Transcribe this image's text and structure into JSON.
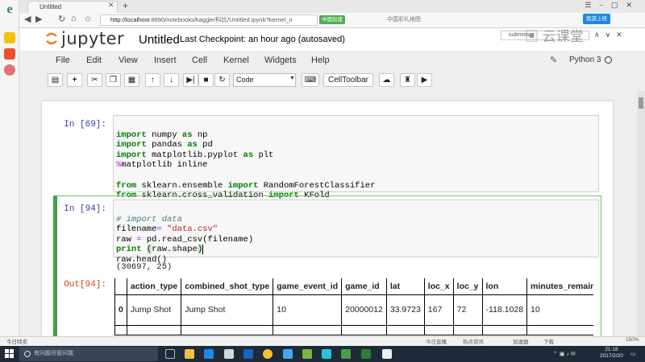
{
  "browser": {
    "tab_title": "Untitled",
    "url_host": "http://localhost",
    "url_rest": ":8890/notebooks/kaggle/科比/Untitled.ipynb?kernel_n",
    "url_tag": "中国加速",
    "search_hint": "中国彩礼地图",
    "login_label": "我游上班"
  },
  "overlay": {
    "search_value": "submissio",
    "watermark": "云课堂"
  },
  "jupyter": {
    "logo_text": "jupyter",
    "notebook_title": "Untitled",
    "checkpoint": "Last Checkpoint: an hour ago (autosaved)",
    "kernel": "Python 3",
    "menu": [
      "File",
      "Edit",
      "View",
      "Insert",
      "Cell",
      "Kernel",
      "Widgets",
      "Help"
    ],
    "cell_type": "Code",
    "celltoolbar_label": "CellToolbar"
  },
  "cells": [
    {
      "prompt": "In [69]:",
      "lines": [
        {
          "k1": "import",
          "t1": " numpy ",
          "k2": "as",
          "t2": " np"
        },
        {
          "k1": "import",
          "t1": " pandas ",
          "k2": "as",
          "t2": " pd"
        },
        {
          "k1": "import",
          "t1": " matplotlib.pyplot ",
          "k2": "as",
          "t2": " plt"
        },
        {
          "magic_op": "%",
          "magic": "matplotlib inline"
        },
        {
          "blank": ""
        },
        {
          "k1": "from",
          "t1": " sklearn.ensemble ",
          "k2": "import",
          "t2": " RandomForestClassifier"
        },
        {
          "k1": "from",
          "t1": " sklearn.cross_validation ",
          "k2": "import",
          "t2": " KFold"
        }
      ]
    },
    {
      "prompt": "In [94]:",
      "comment": "# import data",
      "line2_a": "filename",
      "line2_op": "=",
      "line2_str": " \"data.csv\"",
      "line3_a": "raw ",
      "line3_op": "=",
      "line3_b": " pd.read_csv(filename)",
      "line4_kw": "print",
      "line4_a": " ",
      "line4_p1": "(",
      "line4_b": "raw.shape",
      "line4_p2": ")",
      "line5": "raw.head()",
      "output_text": "(30697, 25)",
      "out_prompt": "Out[94]:"
    }
  ],
  "dataframe": {
    "columns": [
      "",
      "action_type",
      "combined_shot_type",
      "game_event_id",
      "game_id",
      "lat",
      "loc_x",
      "loc_y",
      "lon",
      "minutes_remaining"
    ],
    "rows": [
      [
        "0",
        "Jump Shot",
        "Jump Shot",
        "10",
        "20000012",
        "33.9723",
        "167",
        "72",
        "-118.1028",
        "10"
      ],
      [
        "",
        "",
        "",
        "",
        "",
        "",
        "",
        "",
        "",
        ""
      ]
    ]
  },
  "statusbar": {
    "left_text": "今日特卖",
    "center_items": [
      "今日直播",
      "热点资讯",
      "加速器",
      "下载"
    ],
    "zoom": "150%"
  },
  "taskbar": {
    "search_placeholder": "有问题尽管问我",
    "time": "21:18",
    "date": "2017/2/20"
  },
  "colors": {
    "prompt_in": "#303f9f",
    "prompt_out": "#d84315",
    "edit_border": "#42a142",
    "keyword": "#008000",
    "string": "#ba2121",
    "taskbar": "#1f2a38"
  }
}
